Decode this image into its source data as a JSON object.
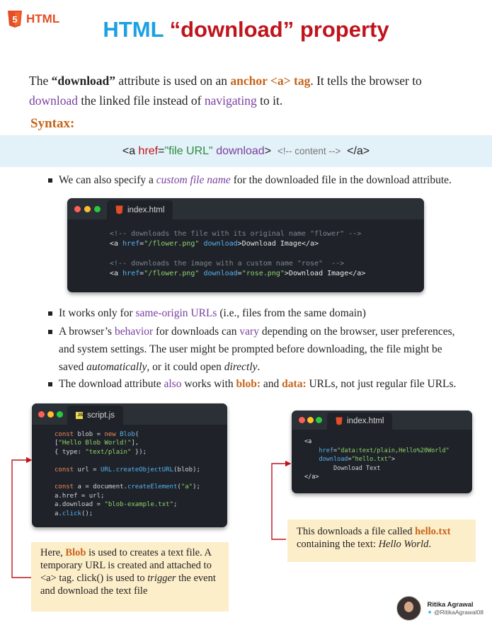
{
  "header": {
    "logo_number": "5",
    "logo_text": "HTML",
    "title_html": "HTML",
    "title_rest": "“download” property"
  },
  "intro": {
    "p1": "The ",
    "q": "“download”",
    "p2": " attribute is used on an ",
    "anchor": "anchor <a> tag",
    "p3": ". It tells the browser to ",
    "download": "download",
    "p4": " the linked file instead of ",
    "navigating": "navigating",
    "p5": " to it."
  },
  "syntax": {
    "heading": "Syntax:",
    "open": "<a ",
    "href": "href",
    "eq": "=",
    "url": "\"file URL\"",
    "space": " ",
    "download": "download",
    "close": ">",
    "comment": "<!-- content -->",
    "end": "</a>"
  },
  "bullet1": {
    "p1": "We can also specify a ",
    "em": "custom file name",
    "p2": " for the downloaded file in the download attribute."
  },
  "window1": {
    "filename": "index.html",
    "line1": "<!-- downloads the file with its original name \"flower\" -->",
    "line2_a": "<a ",
    "line2_b": "href",
    "line2_c": "=",
    "line2_d": "\"/flower.png\"",
    "line2_e": " download",
    "line2_f": ">Download Image</a>",
    "line3": "<!-- downloads the image with a custom name \"rose\"  -->",
    "line4_a": "<a ",
    "line4_b": "href",
    "line4_c": "=",
    "line4_d": "\"/flower.png\"",
    "line4_e": " download",
    "line4_f": "=",
    "line4_g": "\"rose.png\"",
    "line4_h": ">Download Image</a>"
  },
  "bullets": {
    "b2_p1": "It works only for ",
    "b2_link": "same-origin URLs",
    "b2_p2": " (i.e., files from the same domain)",
    "b3_p1": "A browser’s ",
    "b3_behavior": "behavior",
    "b3_p2": " for downloads can ",
    "b3_vary": "vary",
    "b3_p3": " depending on the browser, user preferences,",
    "b3_l2": "and system settings. The user might be prompted before downloading, the file might be",
    "b3_l3a": "saved ",
    "b3_auto": "automatically",
    "b3_l3b": ", or it could open ",
    "b3_direct": "directly",
    "b3_l3c": ".",
    "b4_p1": "The download attribute ",
    "b4_also": "also",
    "b4_p2": " works with ",
    "b4_blob": "blob:",
    "b4_p3": " and ",
    "b4_data": "data:",
    "b4_p4": " URLs, not just regular file URLs."
  },
  "window2": {
    "filename": "script.js",
    "badge": "JS",
    "l1_kw": "const",
    "l1_a": " blob = ",
    "l1_new": "new",
    "l1_fn": " Blob",
    "l1_b": "(",
    "l2_a": "[",
    "l2_str": "\"Hello Blob World!\"",
    "l2_b": "],",
    "l3_a": "{ type: ",
    "l3_str": "\"text/plain\"",
    "l3_b": " });",
    "l4_kw": "const",
    "l4_a": " url = ",
    "l4_fn": "URL.createObjectURL",
    "l4_b": "(blob);",
    "l5_kw": "const",
    "l5_a": " a = document.",
    "l5_fn": "createElement",
    "l5_b": "(",
    "l5_str": "\"a\"",
    "l5_c": ");",
    "l6": "a.href = url;",
    "l7_a": "a.download = ",
    "l7_str": "\"blob-example.txt\"",
    "l7_b": ";",
    "l8_a": "a.",
    "l8_fn": "click",
    "l8_b": "();"
  },
  "window3": {
    "filename": "index.html",
    "l1": "<a",
    "l2_attr": "href",
    "l2_eq": "=",
    "l2_str": "\"data:text/plain,Hello%20World\"",
    "l3_attr": "download",
    "l3_eq": "=",
    "l3_str": "\"hello.txt\"",
    "l3_end": ">",
    "l4": "Download Text",
    "l5": "</a>"
  },
  "note1": {
    "p1": "Here, ",
    "blob": "Blob",
    "p2": " is used to creates a text file. A temporary URL is created and attached to <a> tag. click() is used to ",
    "trigger": "trigger",
    "p3": " the event and download the text file"
  },
  "note2": {
    "p1": "This downloads a file called ",
    "file": "hello.txt",
    "p2": " containing the text: ",
    "text": "Hello World",
    "p3": "."
  },
  "author": {
    "name": "Ritika Agrawal",
    "handle": "@RitikaAgrawal08"
  },
  "colors": {
    "html_orange": "#e44d26",
    "title_blue": "#1ba1e2",
    "title_red": "#c0141c",
    "accent_orange": "#c5641a",
    "accent_purple": "#7a3fa0",
    "syntax_bg": "#e3f1f8",
    "note_bg": "#fdeeca",
    "code_bg": "#1f2329"
  }
}
